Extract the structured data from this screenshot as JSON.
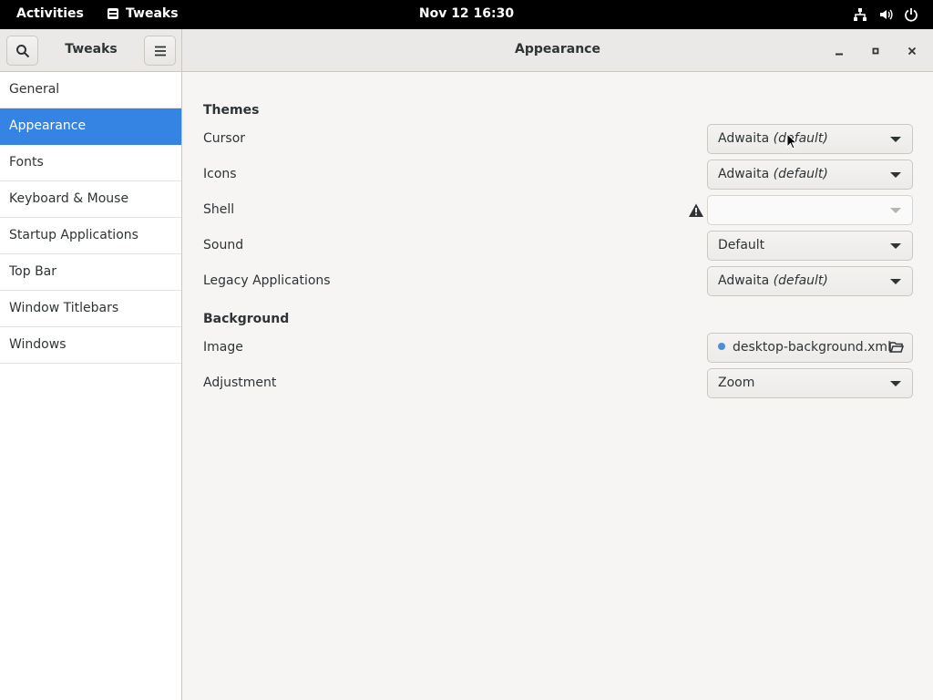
{
  "topbar": {
    "activities": "Activities",
    "app_name": "Tweaks",
    "clock": "Nov 12  16:30",
    "status_icons": [
      "network-icon",
      "volume-icon",
      "power-icon"
    ]
  },
  "header": {
    "sidebar_title": "Tweaks",
    "page_title": "Appearance"
  },
  "sidebar": {
    "items": [
      {
        "label": "General"
      },
      {
        "label": "Appearance",
        "active": true
      },
      {
        "label": "Fonts"
      },
      {
        "label": "Keyboard & Mouse"
      },
      {
        "label": "Startup Applications"
      },
      {
        "label": "Top Bar"
      },
      {
        "label": "Window Titlebars"
      },
      {
        "label": "Windows"
      }
    ]
  },
  "themes": {
    "title": "Themes",
    "cursor": {
      "label": "Cursor",
      "value": "Adwaita",
      "suffix": "(default)"
    },
    "icons": {
      "label": "Icons",
      "value": "Adwaita",
      "suffix": "(default)"
    },
    "shell": {
      "label": "Shell",
      "value": ""
    },
    "sound": {
      "label": "Sound",
      "value": "Default"
    },
    "legacy": {
      "label": "Legacy Applications",
      "value": "Adwaita",
      "suffix": "(default)"
    }
  },
  "background": {
    "title": "Background",
    "image": {
      "label": "Image",
      "value": "desktop-background.xml"
    },
    "adjustment": {
      "label": "Adjustment",
      "value": "Zoom"
    }
  },
  "colors": {
    "accent": "#3584e4",
    "topbar_bg": "#000000",
    "window_bg": "#f6f5f4"
  }
}
